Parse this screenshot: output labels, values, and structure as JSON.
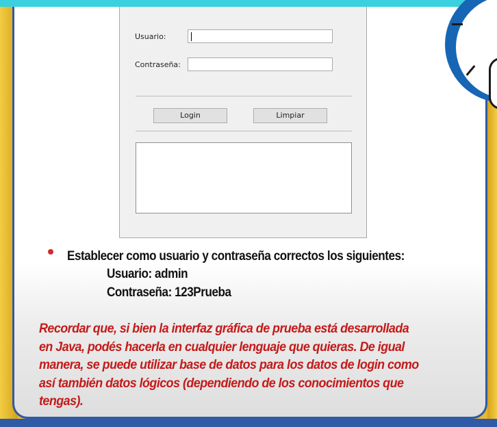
{
  "login_form": {
    "username_label": "Usuario:",
    "password_label": "Contraseña:",
    "username_value": "",
    "password_value": "",
    "login_button": "Login",
    "clear_button": "Limpiar",
    "output_text": ""
  },
  "instructions": {
    "bullet_text": "Establecer como usuario y contraseña correctos los siguientes:",
    "username_line": "Usuario: admin",
    "password_line": "Contraseña: 123Prueba"
  },
  "note_lines": [
    "Recordar que, si bien la interfaz gráfica de prueba está desarrollada",
    "en Java, podés hacerla en cualquier lenguaje que quieras. De igual",
    "manera, se puede utilizar base de datos para los datos de login como",
    "así también datos lógicos (dependiendo de los conocimientos que",
    "tengas)."
  ],
  "colors": {
    "accent_blue": "#2e5aa6",
    "note_red": "#c41a1a",
    "frame_yellow": "#e9b830"
  }
}
